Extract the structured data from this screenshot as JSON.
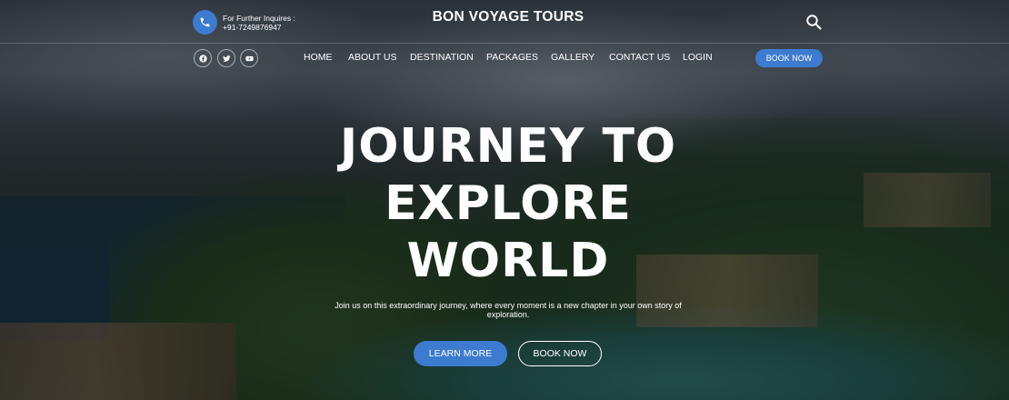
{
  "topbar": {
    "inquiry_label": "For Further Inquires :",
    "phone_number": "+91-7249876947",
    "brand": "BON VOYAGE TOURS"
  },
  "social": [
    "facebook-icon",
    "twitter-icon",
    "youtube-icon"
  ],
  "nav": {
    "items": [
      "HOME",
      "ABOUT US",
      "DESTINATION",
      "PACKAGES",
      "GALLERY",
      "CONTACT US",
      "LOGIN"
    ],
    "book_button": "BOOK NOW"
  },
  "hero": {
    "headline": [
      "JOURNEY TO",
      "EXPLORE",
      "WORLD"
    ],
    "subtitle": "Join us on this extraordinary journey, where every moment is a new chapter in your own story of exploration.",
    "learn_more": "LEARN MORE",
    "book_now": "BOOK NOW"
  },
  "colors": {
    "accent": "#3d7bd0",
    "text": "#ffffff"
  }
}
